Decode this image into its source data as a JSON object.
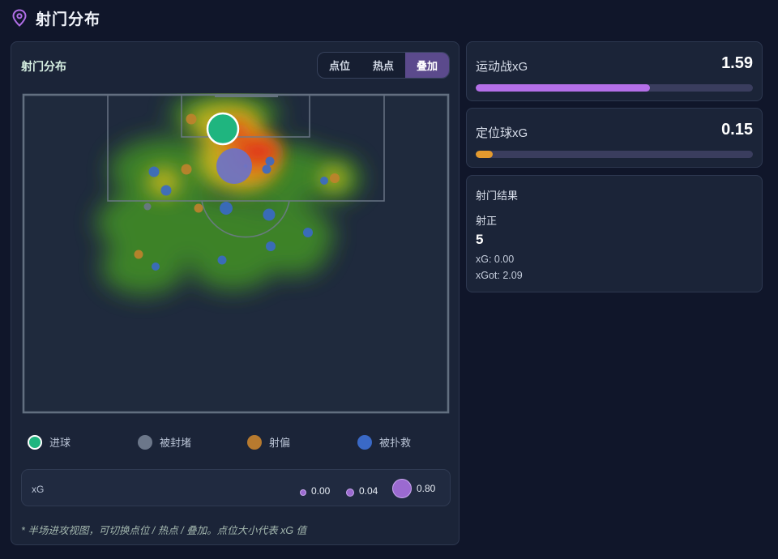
{
  "header": {
    "title": "射门分布",
    "icon": "location-pin-icon",
    "icon_color": "#b06ee6"
  },
  "panel": {
    "title": "射门分布",
    "tabs": [
      {
        "label": "点位",
        "active": false
      },
      {
        "label": "热点",
        "active": false
      },
      {
        "label": "叠加",
        "active": true
      }
    ]
  },
  "legend": [
    {
      "label": "进球",
      "color": "#1fb57f"
    },
    {
      "label": "被封堵",
      "color": "#6c778a"
    },
    {
      "label": "射偏",
      "color": "#c0822c"
    },
    {
      "label": "被扑救",
      "color": "#3a69c6"
    }
  ],
  "xg_scale": {
    "label": "xG",
    "entries": [
      {
        "label": "0.00"
      },
      {
        "label": "0.04"
      },
      {
        "label": "0.80"
      }
    ]
  },
  "footnote": "* 半场进攻视图，可切换点位 / 热点 / 叠加。点位大小代表 xG 值",
  "stats": {
    "open_play": {
      "label": "运动战xG",
      "value": "1.59",
      "fraction": 0.63,
      "color": "#b46fe8"
    },
    "set_piece": {
      "label": "定位球xG",
      "value": "0.15",
      "fraction": 0.06,
      "color": "#e49a2e"
    }
  },
  "result": {
    "title": "射门结果",
    "category": "射正",
    "count": "5",
    "xg": "xG: 0.00",
    "xgot": "xGot: 2.09"
  }
}
